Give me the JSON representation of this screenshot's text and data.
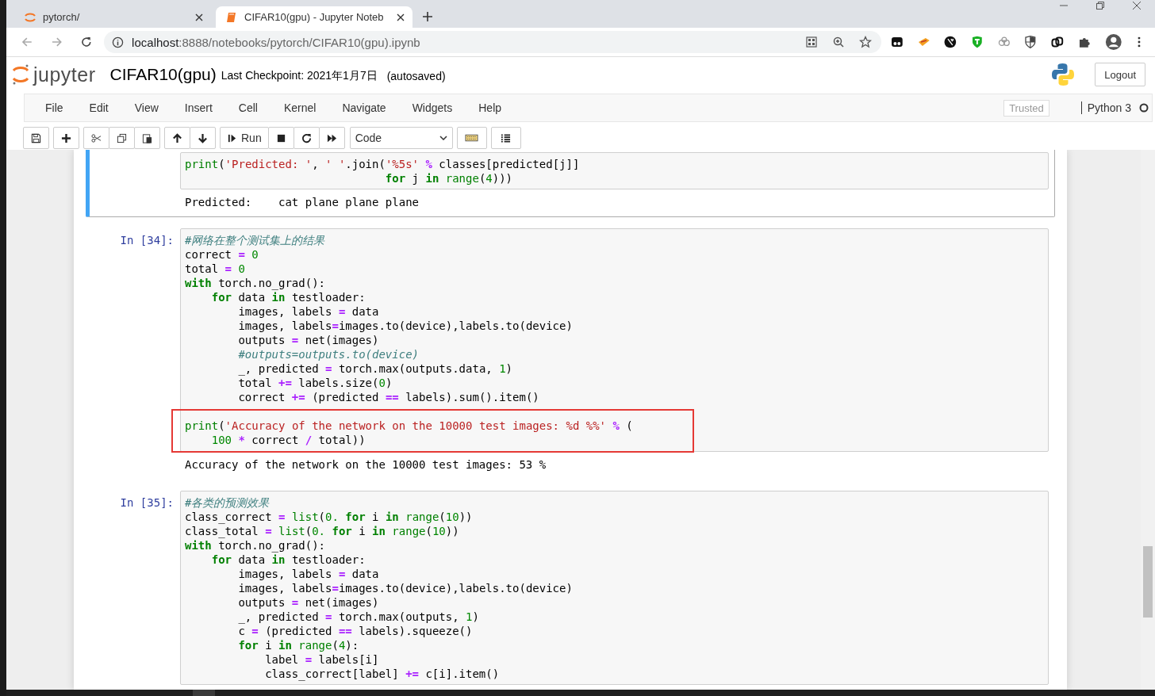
{
  "browser": {
    "tabs": [
      {
        "kind": "jupyter",
        "title": "pytorch/",
        "selected": false
      },
      {
        "kind": "notebook",
        "title": "CIFAR10(gpu) - Jupyter Noteb",
        "selected": true
      }
    ],
    "url_host": "localhost",
    "url_path": ":8888/notebooks/pytorch/CIFAR10(gpu).ipynb"
  },
  "header": {
    "logo_text": "jupyter",
    "notebook_name": "CIFAR10(gpu)",
    "checkpoint": "Last Checkpoint: 2021年1月7日",
    "autosave": "(autosaved)",
    "logout": "Logout"
  },
  "menu": {
    "items": [
      "File",
      "Edit",
      "View",
      "Insert",
      "Cell",
      "Kernel",
      "Navigate",
      "Widgets",
      "Help"
    ],
    "trusted": "Trusted",
    "kernel": "Python 3",
    "kernel_busy": false
  },
  "toolbar": {
    "run": "Run",
    "cell_type": "Code"
  },
  "cells": [
    {
      "selected": true,
      "blocks": [
        {
          "highlighted": false,
          "lines": [
            [
              {
                "kind": "builtin",
                "text": "print"
              },
              {
                "kind": "plain",
                "text": "("
              },
              {
                "kind": "string",
                "text": "'Predicted: '"
              },
              {
                "kind": "plain",
                "text": ", "
              },
              {
                "kind": "string",
                "text": "' '"
              },
              {
                "kind": "plain",
                "text": ".join("
              },
              {
                "kind": "string",
                "text": "'%5s'"
              },
              {
                "kind": "operator",
                "text": " %"
              },
              {
                "kind": "plain",
                "text": " classes[predicted[j]]"
              }
            ],
            [
              {
                "kind": "keyword",
                "text": "                              for"
              },
              {
                "kind": "plain",
                "text": " j "
              },
              {
                "kind": "keyword",
                "text": "in"
              },
              {
                "kind": "builtin",
                "text": " range"
              },
              {
                "kind": "plain",
                "text": "("
              },
              {
                "kind": "number",
                "text": "4"
              },
              {
                "kind": "plain",
                "text": ")))"
              }
            ]
          ]
        }
      ],
      "output": "Predicted:    cat plane plane plane"
    },
    {
      "prompt": "In [34]:",
      "selected": false,
      "blocks": [
        {
          "highlighted": false,
          "lines": [
            [
              {
                "kind": "comment",
                "text": "#网络在整个测试集上的结果"
              }
            ],
            [
              {
                "kind": "plain",
                "text": "correct "
              },
              {
                "kind": "operator",
                "text": "="
              },
              {
                "kind": "number",
                "text": " 0"
              }
            ],
            [
              {
                "kind": "plain",
                "text": "total "
              },
              {
                "kind": "operator",
                "text": "="
              },
              {
                "kind": "number",
                "text": " 0"
              }
            ],
            [
              {
                "kind": "keyword",
                "text": "with"
              },
              {
                "kind": "plain",
                "text": " torch.no_grad():"
              }
            ],
            [
              {
                "kind": "keyword",
                "text": "    for"
              },
              {
                "kind": "plain",
                "text": " data "
              },
              {
                "kind": "keyword",
                "text": "in"
              },
              {
                "kind": "plain",
                "text": " testloader:"
              }
            ],
            [
              {
                "kind": "plain",
                "text": "        images, labels "
              },
              {
                "kind": "operator",
                "text": "="
              },
              {
                "kind": "plain",
                "text": " data"
              }
            ],
            [
              {
                "kind": "plain",
                "text": "        images, labels"
              },
              {
                "kind": "operator",
                "text": "="
              },
              {
                "kind": "plain",
                "text": "images.to(device),labels.to(device)"
              }
            ],
            [
              {
                "kind": "plain",
                "text": "        outputs "
              },
              {
                "kind": "operator",
                "text": "="
              },
              {
                "kind": "plain",
                "text": " net(images)"
              }
            ],
            [
              {
                "kind": "comment",
                "text": "        #outputs=outputs.to(device)"
              }
            ],
            [
              {
                "kind": "plain",
                "text": "        _, predicted "
              },
              {
                "kind": "operator",
                "text": "="
              },
              {
                "kind": "plain",
                "text": " torch.max(outputs.data, "
              },
              {
                "kind": "number",
                "text": "1"
              },
              {
                "kind": "plain",
                "text": ")"
              }
            ],
            [
              {
                "kind": "plain",
                "text": "        total "
              },
              {
                "kind": "operator",
                "text": "+="
              },
              {
                "kind": "plain",
                "text": " labels.size("
              },
              {
                "kind": "number",
                "text": "0"
              },
              {
                "kind": "plain",
                "text": ")"
              }
            ],
            [
              {
                "kind": "plain",
                "text": "        correct "
              },
              {
                "kind": "operator",
                "text": "+="
              },
              {
                "kind": "plain",
                "text": " (predicted "
              },
              {
                "kind": "operator",
                "text": "=="
              },
              {
                "kind": "plain",
                "text": " labels).sum().item()"
              }
            ]
          ]
        },
        {
          "highlighted": true,
          "lines": [
            [
              {
                "kind": "builtin",
                "text": "print"
              },
              {
                "kind": "plain",
                "text": "("
              },
              {
                "kind": "string",
                "text": "'Accuracy of the network on the 10000 test images: %d %%'"
              },
              {
                "kind": "operator",
                "text": " %"
              },
              {
                "kind": "plain",
                "text": " ("
              }
            ],
            [
              {
                "kind": "number",
                "text": "    100"
              },
              {
                "kind": "operator",
                "text": " *"
              },
              {
                "kind": "plain",
                "text": " correct "
              },
              {
                "kind": "operator",
                "text": "/"
              },
              {
                "kind": "plain",
                "text": " total))"
              }
            ]
          ]
        }
      ],
      "output": "Accuracy of the network on the 10000 test images: 53 %"
    },
    {
      "prompt": "In [35]:",
      "selected": false,
      "blocks": [
        {
          "highlighted": false,
          "lines": [
            [
              {
                "kind": "comment",
                "text": "#各类的预测效果"
              }
            ],
            [
              {
                "kind": "plain",
                "text": "class_correct "
              },
              {
                "kind": "operator",
                "text": "="
              },
              {
                "kind": "builtin",
                "text": " list"
              },
              {
                "kind": "plain",
                "text": "("
              },
              {
                "kind": "number",
                "text": "0."
              },
              {
                "kind": "keyword",
                "text": " for"
              },
              {
                "kind": "plain",
                "text": " i "
              },
              {
                "kind": "keyword",
                "text": "in"
              },
              {
                "kind": "builtin",
                "text": " range"
              },
              {
                "kind": "plain",
                "text": "("
              },
              {
                "kind": "number",
                "text": "10"
              },
              {
                "kind": "plain",
                "text": "))"
              }
            ],
            [
              {
                "kind": "plain",
                "text": "class_total "
              },
              {
                "kind": "operator",
                "text": "="
              },
              {
                "kind": "builtin",
                "text": " list"
              },
              {
                "kind": "plain",
                "text": "("
              },
              {
                "kind": "number",
                "text": "0."
              },
              {
                "kind": "keyword",
                "text": " for"
              },
              {
                "kind": "plain",
                "text": " i "
              },
              {
                "kind": "keyword",
                "text": "in"
              },
              {
                "kind": "builtin",
                "text": " range"
              },
              {
                "kind": "plain",
                "text": "("
              },
              {
                "kind": "number",
                "text": "10"
              },
              {
                "kind": "plain",
                "text": "))"
              }
            ],
            [
              {
                "kind": "keyword",
                "text": "with"
              },
              {
                "kind": "plain",
                "text": " torch.no_grad():"
              }
            ],
            [
              {
                "kind": "keyword",
                "text": "    for"
              },
              {
                "kind": "plain",
                "text": " data "
              },
              {
                "kind": "keyword",
                "text": "in"
              },
              {
                "kind": "plain",
                "text": " testloader:"
              }
            ],
            [
              {
                "kind": "plain",
                "text": "        images, labels "
              },
              {
                "kind": "operator",
                "text": "="
              },
              {
                "kind": "plain",
                "text": " data"
              }
            ],
            [
              {
                "kind": "plain",
                "text": "        images, labels"
              },
              {
                "kind": "operator",
                "text": "="
              },
              {
                "kind": "plain",
                "text": "images.to(device),labels.to(device)"
              }
            ],
            [
              {
                "kind": "plain",
                "text": "        outputs "
              },
              {
                "kind": "operator",
                "text": "="
              },
              {
                "kind": "plain",
                "text": " net(images)"
              }
            ],
            [
              {
                "kind": "plain",
                "text": "        _, predicted "
              },
              {
                "kind": "operator",
                "text": "="
              },
              {
                "kind": "plain",
                "text": " torch.max(outputs, "
              },
              {
                "kind": "number",
                "text": "1"
              },
              {
                "kind": "plain",
                "text": ")"
              }
            ],
            [
              {
                "kind": "plain",
                "text": "        c "
              },
              {
                "kind": "operator",
                "text": "="
              },
              {
                "kind": "plain",
                "text": " (predicted "
              },
              {
                "kind": "operator",
                "text": "=="
              },
              {
                "kind": "plain",
                "text": " labels).squeeze()"
              }
            ],
            [
              {
                "kind": "keyword",
                "text": "        for"
              },
              {
                "kind": "plain",
                "text": " i "
              },
              {
                "kind": "keyword",
                "text": "in"
              },
              {
                "kind": "builtin",
                "text": " range"
              },
              {
                "kind": "plain",
                "text": "("
              },
              {
                "kind": "number",
                "text": "4"
              },
              {
                "kind": "plain",
                "text": "):"
              }
            ],
            [
              {
                "kind": "plain",
                "text": "            label "
              },
              {
                "kind": "operator",
                "text": "="
              },
              {
                "kind": "plain",
                "text": " labels[i]"
              }
            ],
            [
              {
                "kind": "plain",
                "text": "            class_correct[label] "
              },
              {
                "kind": "operator",
                "text": "+="
              },
              {
                "kind": "plain",
                "text": " c[i].item()"
              }
            ]
          ]
        }
      ]
    }
  ]
}
